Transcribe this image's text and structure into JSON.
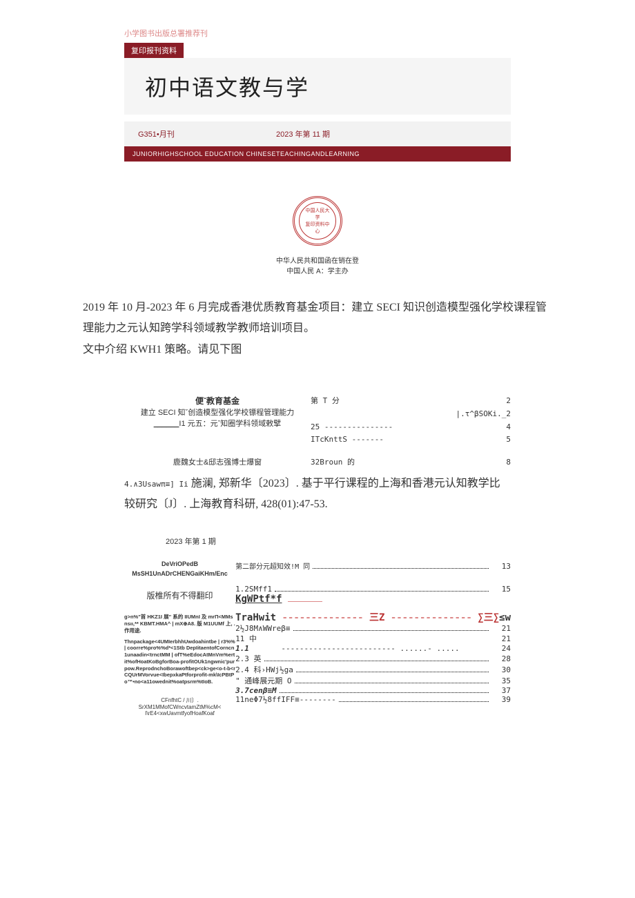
{
  "header": {
    "top_label": "小学图书出版总署推荐刊",
    "sub_label": "复印报刊资料",
    "journal_title": "初中语文教与学",
    "issue_code": "G351•月刊",
    "issue_label": "2023 年第 11 期",
    "eng_line": "JUNIORHIGHSCHOOL EDUCATION CHINESETEACHINGANDLEARNING",
    "seal_line1": "中国人民大学",
    "seal_line2": "复印资料中心",
    "sponsor_line1": "中华人民共和国函在销在登",
    "sponsor_line2": "中国人民 A：学主办"
  },
  "body": {
    "para1": "2019 年 10 月-2023 年 6 月完成香港优质教育基金项目：建立 SECI 知识创造模型强化学校课程管理能力之元认知跨学科领域教学教师培训项目。",
    "para2": "文中介绍 KWH1 策略。请见下图"
  },
  "fund": {
    "title": "便ˇ教育基金",
    "line1": "建立 SECI 知ˇ创造模型强化学校镖程管理能力",
    "line2_pre": "______",
    "line2": "I1 元五：元ˇ知圈学科领域敕擘",
    "author": "鹿魏女士&邸志强博士爆窗"
  },
  "mini_toc": {
    "r1a": "第 T 分",
    "r1b": "2",
    "r2": "|.τ^βSOKi._2",
    "r3a": "25 ---------------",
    "r3b": "4",
    "r4a": "ITcKnttS -------",
    "r4b": "5",
    "r5a": "32Broun 的",
    "r5b": "8",
    "r6": "4.∧3Usawπ≡] Ii"
  },
  "citation": "施澜, 郑新华〔2023〕. 基于平行课程的上海和香港元认知教学比较研究〔J〕. 上海教育科研, 428(01):47-53.",
  "issue2": "2023 年第 1 期",
  "lower_left": {
    "h1": "DeVriOPedB",
    "h2": "MsSH1UnADrCHENGaiKHm/Enc",
    "copyright": "版椎所有不得翻印",
    "tiny1": "g>n%\"首 HKZ1I 展\" 系的 IIUMnI 及 mrΠ<MMsnsıı,** KBMT.HMA^ | mX⊕A8. 版 M1UUMf 上, . 作用途.",
    "tiny2": "Thnpackage<4UMIerbhhUwdoahintbe | r3%% | coorre%pro%%d*<1Stb DepIitaentofCorncn1unaadin<trnctMM | ofT%eEdocAtMnVm%ertit%ofHoatKoBgforBoa-profitOUk1ngwnic'purpow.ReprodnchoBorawoftbep<ck>ge<o-t-b<rCQUrMVorvue<IbepxkaPtforprofit-mk\\IcPBtPo™•no<a11owednit%oatpsrm%tIoB.",
    "foot1": "CFnfhtC / 川〕. SrXM1MMofCWncvtamZtM%cM<",
    "foot2": "I\\rE4<xwUavmtfyofHoafKoaf"
  },
  "toc": [
    {
      "label": "第二部分元超知效!M 同",
      "page": "13"
    },
    {
      "label": "1.2SMff1",
      "page": "15"
    },
    {
      "label": "KgWPtf*f",
      "suffix_pink": "-",
      "big": true
    },
    {
      "label": "TraHwit -------------- 三Z -------------- ∑三∑≤w",
      "colored": true
    },
    {
      "label": "2½J8M∧WWreβ≡",
      "page": "21"
    },
    {
      "label": "11 中",
      "page": "21"
    },
    {
      "label_i": "1.1",
      "page": "24",
      "dots": "------------------------- ......- ....."
    },
    {
      "label": "2.3                         英",
      "page": "28"
    },
    {
      "label": "2.4                科›HWj½ga",
      "page": "30"
    },
    {
      "label": "\" 通峰展元期 O",
      "page": "35"
    },
    {
      "label_i": "3.7cenβ≡M",
      "page": "37"
    },
    {
      "label": "11neΦ7½8ffIFF≡--------",
      "page": "39"
    }
  ]
}
